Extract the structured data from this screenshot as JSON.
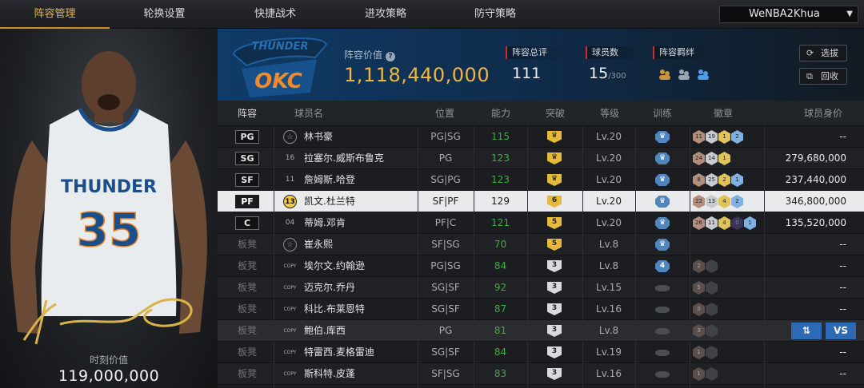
{
  "tabs": [
    {
      "label": "阵容管理",
      "active": true
    },
    {
      "label": "轮换设置",
      "active": false
    },
    {
      "label": "快捷战术",
      "active": false
    },
    {
      "label": "进攻策略",
      "active": false
    },
    {
      "label": "防守策略",
      "active": false
    }
  ],
  "account": {
    "name": "WeNBA2Khua"
  },
  "featured_player": {
    "number": "35",
    "jersey_team": "THUNDER",
    "moment_value_label": "时刻价值",
    "moment_value": "119,000,000"
  },
  "team": {
    "logo_text": "OKC",
    "logo_top_text": "THUNDER"
  },
  "lineup": {
    "value_label": "阵容价值",
    "value": "1,118,440,000",
    "total_rating_label": "阵容总评",
    "total_rating": "111",
    "player_count_label": "球员数",
    "player_count": "15",
    "player_count_max": "/300",
    "bonds_label": "阵容羁绊"
  },
  "buttons": {
    "select": "选拔",
    "recycle": "回收"
  },
  "columns": [
    "阵容",
    "球员名",
    "位置",
    "能力",
    "突破",
    "等级",
    "训练",
    "徽章",
    "球员身价"
  ],
  "rows": [
    {
      "slot": "PG",
      "starter": true,
      "num": "☆",
      "num_style": "star",
      "name": "林书豪",
      "position": "PG|SG",
      "ability": "115",
      "break": "♛",
      "break_style": "gold",
      "level": "Lv.20",
      "train": "♛",
      "train_style": "blue",
      "badges": [
        {
          "t": "11",
          "c": "bronze"
        },
        {
          "t": "19",
          "c": "silver"
        },
        {
          "t": "1",
          "c": "gold"
        },
        {
          "t": "2",
          "c": "blue"
        }
      ],
      "value": "--"
    },
    {
      "slot": "SG",
      "starter": true,
      "num": "16",
      "num_style": "plain",
      "name": "拉塞尔.威斯布鲁克",
      "position": "PG",
      "ability": "123",
      "break": "♛",
      "break_style": "gold",
      "level": "Lv.20",
      "train": "♛",
      "train_style": "blue",
      "badges": [
        {
          "t": "24",
          "c": "bronze"
        },
        {
          "t": "14",
          "c": "silver"
        },
        {
          "t": "1",
          "c": "gold"
        }
      ],
      "value": "279,680,000"
    },
    {
      "slot": "SF",
      "starter": true,
      "num": "11",
      "num_style": "plain",
      "name": "詹姆斯.哈登",
      "position": "SG|PG",
      "ability": "123",
      "break": "♛",
      "break_style": "gold",
      "level": "Lv.20",
      "train": "♛",
      "train_style": "blue",
      "badges": [
        {
          "t": "8",
          "c": "bronze"
        },
        {
          "t": "25",
          "c": "silver"
        },
        {
          "t": "2",
          "c": "gold"
        },
        {
          "t": "1",
          "c": "blue"
        }
      ],
      "value": "237,440,000"
    },
    {
      "slot": "PF",
      "starter": true,
      "selected": true,
      "num": "13",
      "num_style": "circle",
      "name": "凯文.杜兰特",
      "position": "SF|PF",
      "ability": "129",
      "break": "6",
      "break_style": "gold",
      "level": "Lv.20",
      "train": "♛",
      "train_style": "blue",
      "badges": [
        {
          "t": "22",
          "c": "bronze"
        },
        {
          "t": "13",
          "c": "silver"
        },
        {
          "t": "4",
          "c": "gold"
        },
        {
          "t": "2",
          "c": "blue"
        }
      ],
      "value": "346,800,000"
    },
    {
      "slot": "C",
      "starter": true,
      "num": "04",
      "num_style": "plain",
      "name": "蒂姆.邓肯",
      "position": "PF|C",
      "ability": "121",
      "break": "5",
      "break_style": "gold",
      "level": "Lv.20",
      "train": "♛",
      "train_style": "blue",
      "badges": [
        {
          "t": "26",
          "c": "bronze"
        },
        {
          "t": "11",
          "c": "silver"
        },
        {
          "t": "4",
          "c": "gold"
        },
        {
          "t": "0",
          "c": "purple"
        },
        {
          "t": "1",
          "c": "blue"
        }
      ],
      "value": "135,520,000"
    },
    {
      "slot": "板凳",
      "starter": false,
      "num": "☆",
      "num_style": "star",
      "name": "崔永熙",
      "position": "SF|SG",
      "ability": "70",
      "break": "5",
      "break_style": "gold",
      "level": "Lv.8",
      "train": "♛",
      "train_style": "blue",
      "badges": [],
      "value": "--"
    },
    {
      "slot": "板凳",
      "starter": false,
      "num": "COPY",
      "num_style": "copy",
      "name": "埃尔文.约翰逊",
      "position": "PG|SG",
      "ability": "84",
      "break": "3",
      "break_style": "white",
      "level": "Lv.8",
      "train": "4",
      "train_style": "blue",
      "badges": [
        {
          "t": "2",
          "c": "dim"
        },
        {
          "t": "",
          "c": "empty"
        }
      ],
      "value": "--"
    },
    {
      "slot": "板凳",
      "starter": false,
      "num": "COPY",
      "num_style": "copy",
      "name": "迈克尔.乔丹",
      "position": "SG|SF",
      "ability": "92",
      "break": "3",
      "break_style": "white",
      "level": "Lv.15",
      "train": "",
      "train_style": "dark",
      "badges": [
        {
          "t": "5",
          "c": "dim"
        },
        {
          "t": "",
          "c": "empty"
        }
      ],
      "value": "--"
    },
    {
      "slot": "板凳",
      "starter": false,
      "num": "COPY",
      "num_style": "copy",
      "name": "科比.布莱恩特",
      "position": "SG|SF",
      "ability": "87",
      "break": "3",
      "break_style": "white",
      "level": "Lv.16",
      "train": "",
      "train_style": "dark",
      "badges": [
        {
          "t": "0",
          "c": "dim"
        },
        {
          "t": "",
          "c": "empty"
        }
      ],
      "value": "--"
    },
    {
      "slot": "板凳",
      "starter": false,
      "dimmed": true,
      "num": "COPY",
      "num_style": "copy",
      "name": "鲍伯.库西",
      "position": "PG",
      "ability": "81",
      "break": "3",
      "break_style": "white",
      "level": "Lv.8",
      "train": "",
      "train_style": "dark",
      "badges": [
        {
          "t": "3",
          "c": "dim"
        },
        {
          "t": "",
          "c": "empty"
        }
      ],
      "value": ""
    },
    {
      "slot": "板凳",
      "starter": false,
      "num": "COPY",
      "num_style": "copy",
      "name": "特雷西.麦格雷迪",
      "position": "SG|SF",
      "ability": "84",
      "break": "3",
      "break_style": "white",
      "level": "Lv.19",
      "train": "",
      "train_style": "dark",
      "badges": [
        {
          "t": "1",
          "c": "dim"
        },
        {
          "t": "",
          "c": "empty"
        }
      ],
      "value": "--"
    },
    {
      "slot": "板凳",
      "starter": false,
      "num": "COPY",
      "num_style": "copy",
      "name": "斯科特.皮蓬",
      "position": "SF|SG",
      "ability": "83",
      "break": "3",
      "break_style": "white",
      "level": "Lv.16",
      "train": "",
      "train_style": "dark",
      "badges": [
        {
          "t": "1",
          "c": "dim"
        },
        {
          "t": "",
          "c": "empty"
        }
      ],
      "value": "--"
    }
  ],
  "row_actions": {
    "swap_icon": "⇅",
    "vs_label": "VS"
  }
}
